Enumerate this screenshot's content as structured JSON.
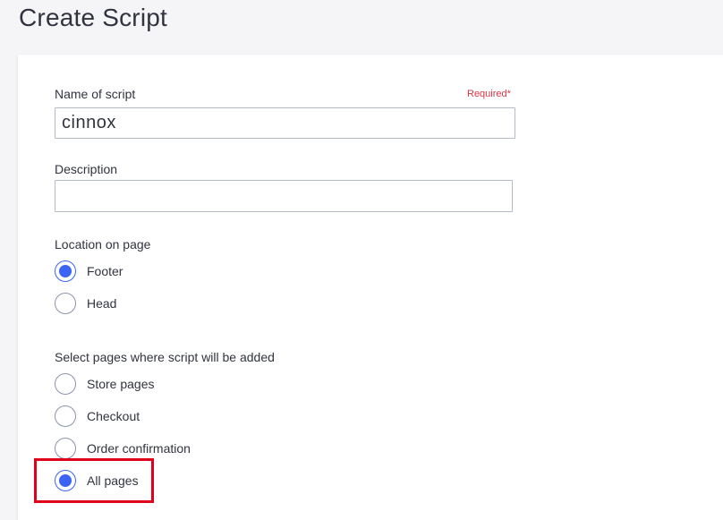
{
  "header": {
    "title": "Create Script"
  },
  "form": {
    "name": {
      "label": "Name of script",
      "required": "Required*",
      "value": "cinnox"
    },
    "description": {
      "label": "Description",
      "value": "",
      "placeholder": ""
    },
    "location": {
      "label": "Location on page",
      "options": [
        {
          "label": "Footer",
          "checked": true
        },
        {
          "label": "Head",
          "checked": false
        }
      ]
    },
    "pages": {
      "label": "Select pages where script will be added",
      "options": [
        {
          "label": "Store pages",
          "checked": false
        },
        {
          "label": "Checkout",
          "checked": false
        },
        {
          "label": "Order confirmation",
          "checked": false
        },
        {
          "label": "All pages",
          "checked": true
        }
      ]
    }
  },
  "colors": {
    "accent": "#3c64f4",
    "required": "#db3643",
    "highlight": "#e0001b"
  }
}
